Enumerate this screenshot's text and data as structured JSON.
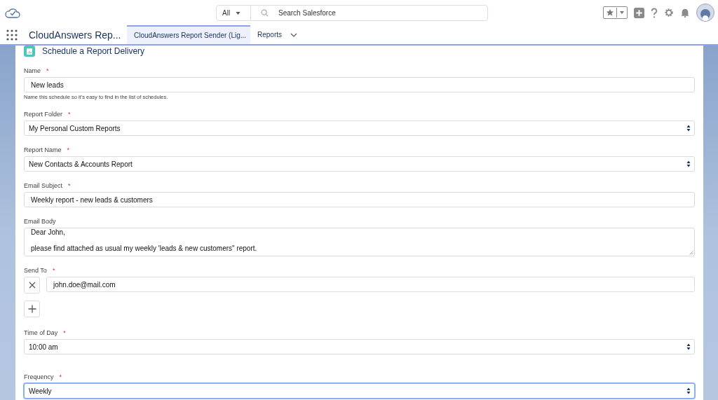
{
  "header": {
    "search": {
      "scope": "All",
      "placeholder": "Search Salesforce"
    }
  },
  "nav": {
    "app_name": "CloudAnswers Rep...",
    "tabs": [
      {
        "label": "CloudAnswers Report Sender (Lig...",
        "selected": true,
        "kind": "page"
      },
      {
        "label": "Reports",
        "selected": false,
        "kind": "menu"
      }
    ]
  },
  "form": {
    "title": "Schedule a Report Delivery",
    "fields": [
      {
        "kind": "text",
        "label": "Name",
        "required_mark": "*",
        "value": "New leads",
        "help": "Name this schedule so it's easy to find in the list of schedules."
      },
      {
        "kind": "select",
        "label": "Report Folder",
        "required_mark": "*",
        "value": "My Personal Custom Reports",
        "focused": false
      },
      {
        "kind": "select",
        "label": "Report Name",
        "required_mark": "*",
        "value": "New Contacts & Accounts Report",
        "focused": false
      },
      {
        "kind": "text",
        "label": "Email Subject",
        "required_mark": "*",
        "value": "Weekly report - new leads & customers"
      },
      {
        "kind": "textarea",
        "label": "Email Body",
        "value": "Dear John,\n\nplease find attached as usual my weekly 'leads & new customers\" report."
      },
      {
        "kind": "recipients",
        "label": "Send To",
        "required_mark": "*",
        "recipients": [
          "john.doe@mail.com"
        ]
      },
      {
        "kind": "select",
        "label": "Time of Day",
        "required_mark": "*",
        "value": "10:00 am",
        "focused": false
      },
      {
        "kind": "select",
        "label": "Frequency",
        "required_mark": "*",
        "value": "Weekly",
        "focused": true
      }
    ]
  }
}
